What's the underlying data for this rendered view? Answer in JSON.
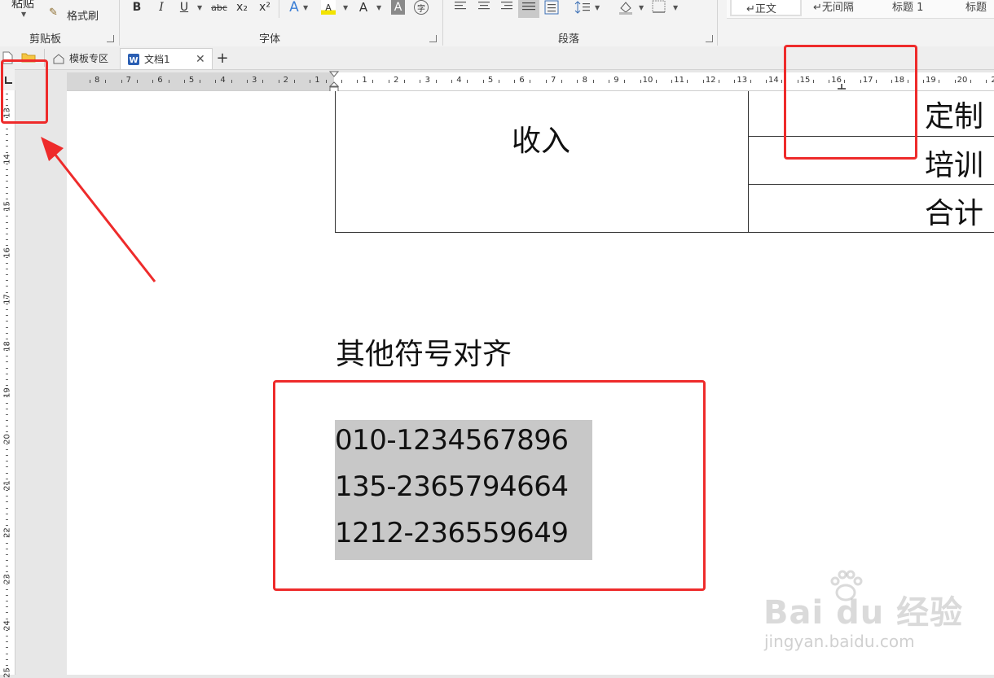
{
  "ribbon": {
    "paste_label": "粘贴",
    "format_painter_label": "格式刷",
    "clipboard_group": "剪贴板",
    "font_group": "字体",
    "paragraph_group": "段落",
    "font_buttons": {
      "bold": "B",
      "italic": "I",
      "underline": "U",
      "strike": "abc",
      "subscript": "x₂",
      "superscript": "x²",
      "font_color": "A",
      "highlight": "A",
      "char_shading": "A",
      "phonetic": "字"
    },
    "styles": [
      "↵正文",
      "↵无间隔",
      "标题 1",
      "标题"
    ]
  },
  "tabs": {
    "template_tab": "模板专区",
    "doc_tab": "文档1",
    "add_tab": "+"
  },
  "ruler": {
    "left_numbers": [
      "8",
      "7",
      "6",
      "5",
      "4",
      "3",
      "2",
      "1"
    ],
    "right_numbers": [
      "1",
      "2",
      "3",
      "4",
      "5",
      "6",
      "7",
      "8",
      "9",
      "10",
      "11",
      "12",
      "13",
      "14",
      "15",
      "16",
      "17",
      "18",
      "19",
      "20",
      "2"
    ],
    "vertical_numbers": [
      "13",
      "14",
      "15",
      "16",
      "17",
      "18",
      "19",
      "20",
      "21",
      "22",
      "23",
      "24",
      "25"
    ]
  },
  "document": {
    "table": {
      "left_cell": "收入",
      "right_cells": [
        "定制",
        "培训",
        "合计"
      ]
    },
    "heading": "其他符号对齐",
    "phone_lines": [
      "010-1234567896",
      "135-2365794664",
      "1212-236559649"
    ]
  },
  "watermark": {
    "brand": "Bai du 经验",
    "url": "jingyan.baidu.com"
  },
  "colors": {
    "annotation_red": "#ee2b2b",
    "selection_gray": "#c8c8c8"
  }
}
